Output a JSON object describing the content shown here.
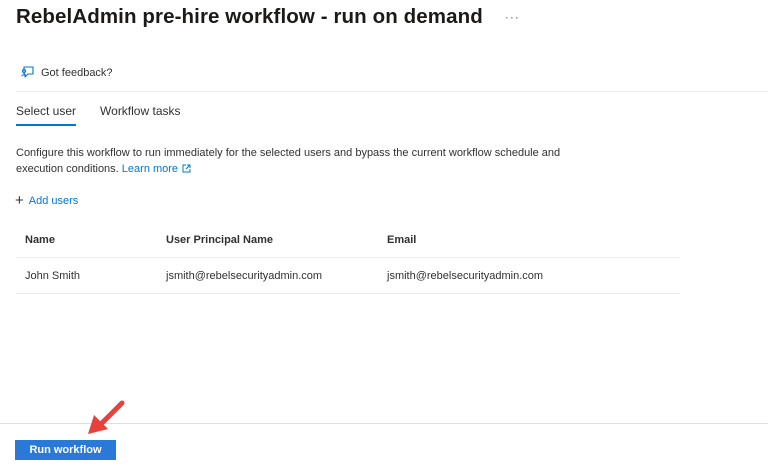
{
  "page": {
    "title": "RebelAdmin pre-hire workflow - run on demand",
    "more_label": "···"
  },
  "command_bar": {
    "feedback_label": "Got feedback?"
  },
  "tabs": [
    {
      "label": "Select user",
      "active": true
    },
    {
      "label": "Workflow tasks",
      "active": false
    }
  ],
  "description": {
    "text": "Configure this workflow to run immediately for the selected users and bypass the current workflow schedule and execution conditions.",
    "link_label": "Learn more"
  },
  "add_users_label": "Add users",
  "table": {
    "columns": [
      "Name",
      "User Principal Name",
      "Email"
    ],
    "rows": [
      [
        "John Smith",
        "jsmith@rebelsecurityadmin.com",
        "jsmith@rebelsecurityadmin.com"
      ]
    ]
  },
  "footer": {
    "run_button_label": "Run workflow"
  },
  "colors": {
    "accent": "#0078d4",
    "primary_button": "#2b79d6",
    "annotation_arrow": "#e8403a"
  }
}
